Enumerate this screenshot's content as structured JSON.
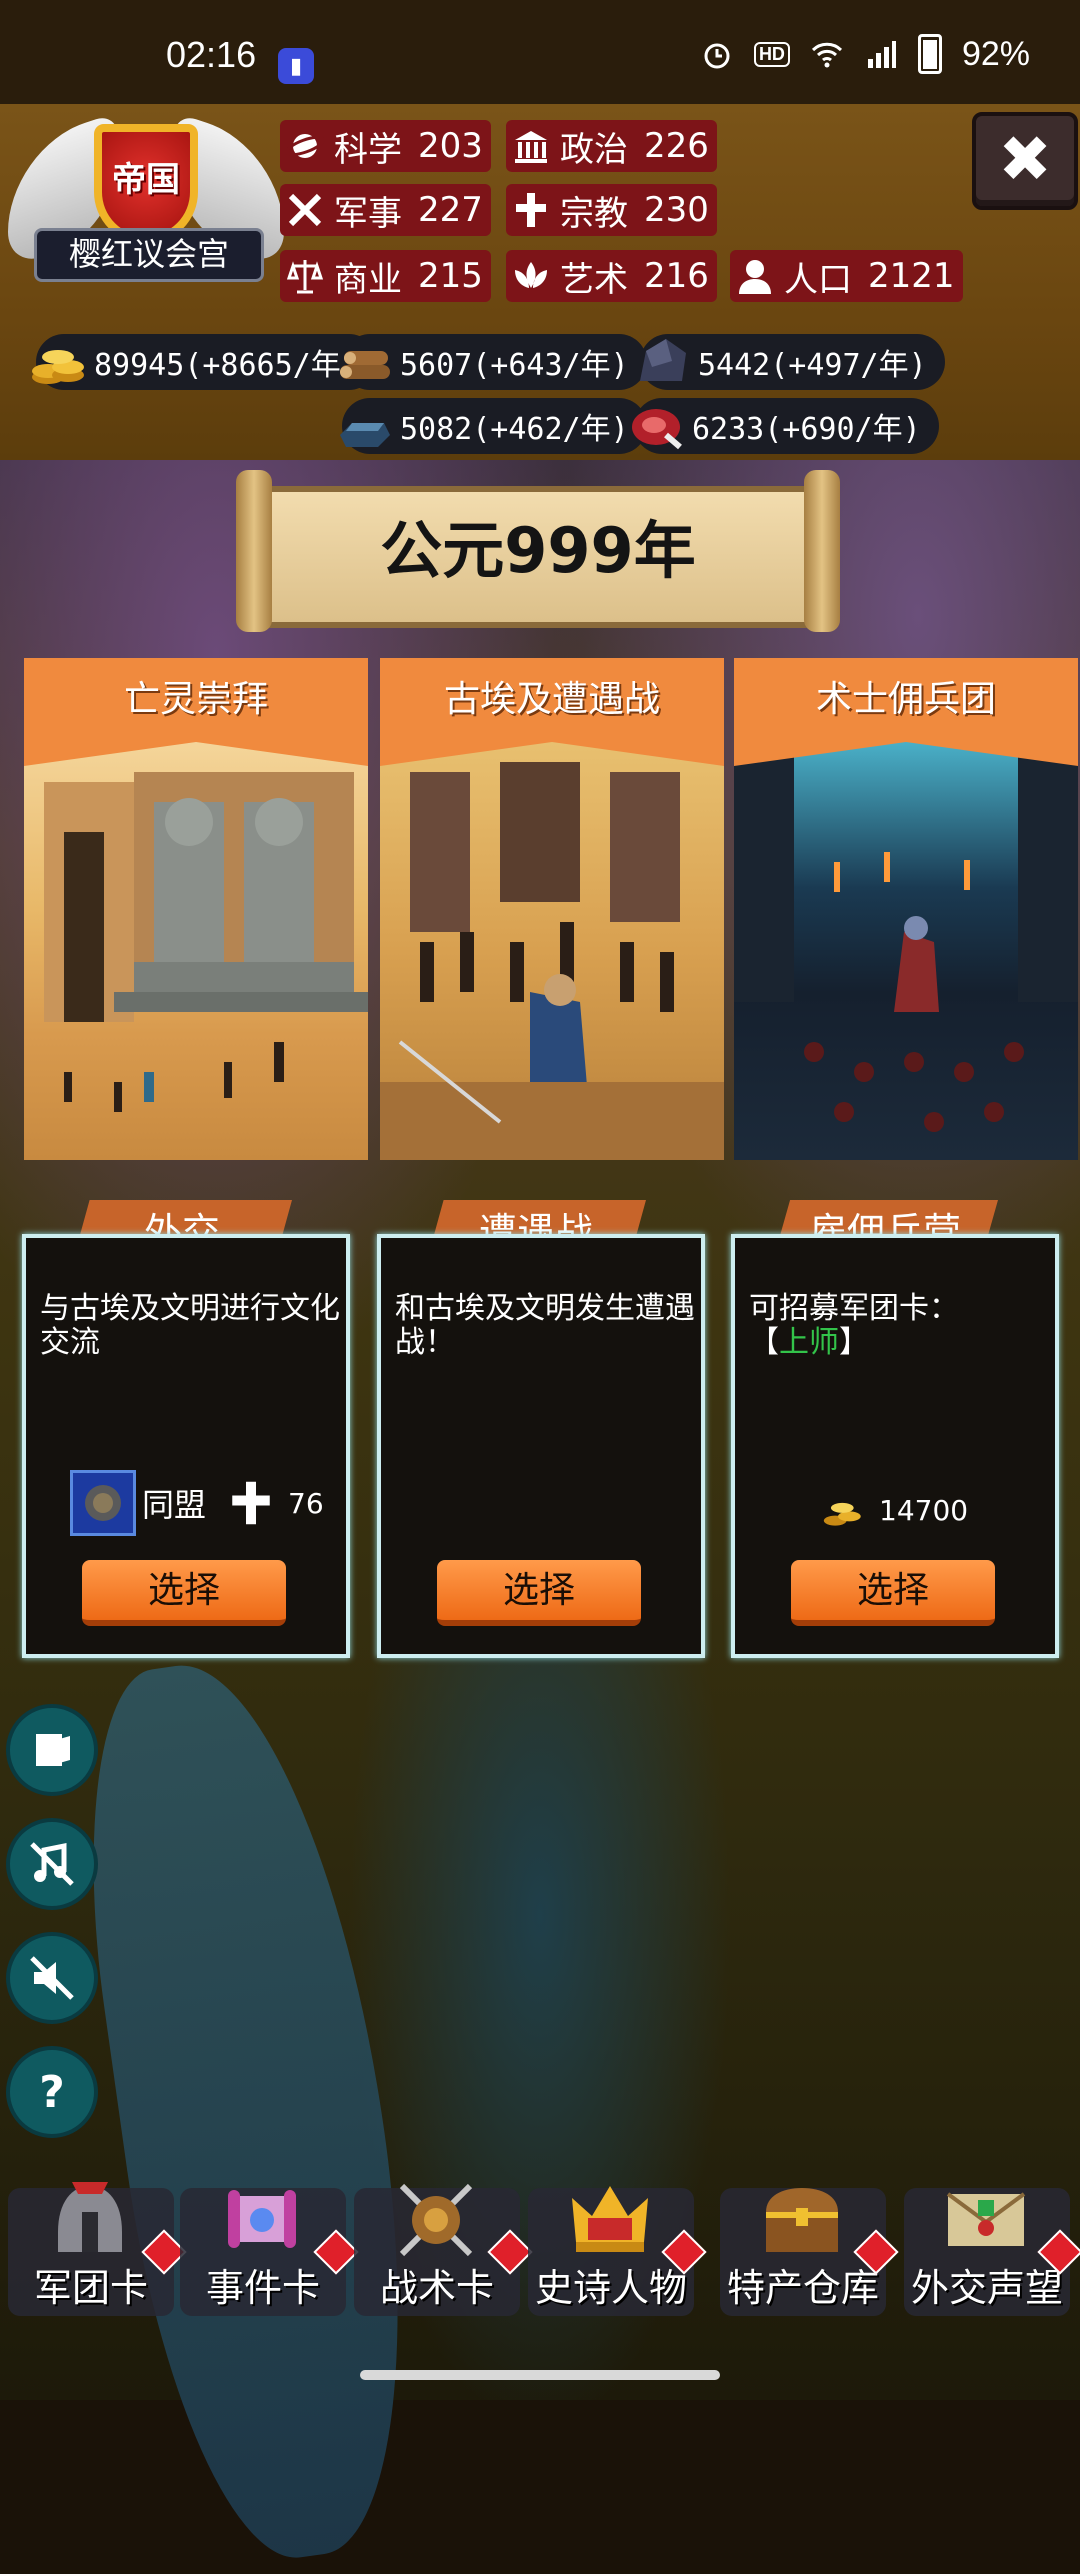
{
  "status_bar": {
    "time": "02:16",
    "battery": "92%"
  },
  "header": {
    "emblem_title": "帝国",
    "emblem_subtitle": "樱红议会宫",
    "stats": [
      {
        "label": "科学",
        "value": "203"
      },
      {
        "label": "政治",
        "value": "226"
      },
      {
        "label": "军事",
        "value": "227"
      },
      {
        "label": "宗教",
        "value": "230"
      },
      {
        "label": "商业",
        "value": "215"
      },
      {
        "label": "艺术",
        "value": "216"
      },
      {
        "label": "人口",
        "value": "2121"
      }
    ],
    "resources": [
      {
        "name": "gold",
        "text": "89945(+8665/年)"
      },
      {
        "name": "wood",
        "text": "5607(+643/年)"
      },
      {
        "name": "stone",
        "text": "5442(+497/年)"
      },
      {
        "name": "iron",
        "text": "5082(+462/年)"
      },
      {
        "name": "meat",
        "text": "6233(+690/年)"
      }
    ]
  },
  "year": "公元999年",
  "cards": [
    {
      "title": "亡灵崇拜",
      "tag": "外交",
      "description": "与古埃及文明进行文化交流",
      "requirement_label": "同盟",
      "requirement_value": "76",
      "select_label": "选择"
    },
    {
      "title": "古埃及遭遇战",
      "tag": "遭遇战",
      "description": "和古埃及文明发生遭遇战！",
      "select_label": "选择"
    },
    {
      "title": "术士佣兵团",
      "tag": "雇佣兵营",
      "description_prefix": "可招募军团卡：",
      "description_open": "【",
      "description_highlight": "上师",
      "description_close": "】",
      "cost": "14700",
      "select_label": "选择"
    }
  ],
  "side_buttons": [
    "deck-icon",
    "music-off-icon",
    "sound-off-icon",
    "help-icon"
  ],
  "nav": [
    {
      "label": "军团卡",
      "icon": "helmet-icon"
    },
    {
      "label": "事件卡",
      "icon": "scroll-icon"
    },
    {
      "label": "战术卡",
      "icon": "shield-swords-icon"
    },
    {
      "label": "史诗人物",
      "icon": "crown-icon"
    },
    {
      "label": "特产仓库",
      "icon": "chest-icon"
    },
    {
      "label": "外交声望",
      "icon": "envelope-icon"
    }
  ],
  "colors": {
    "header_bg": "#6a4610",
    "stat_bg": "#7d1418",
    "card_orange": "#f08a3e",
    "panel_border": "#cdeef0",
    "button_orange": "#ee6a16",
    "highlight_green": "#33c44a"
  }
}
